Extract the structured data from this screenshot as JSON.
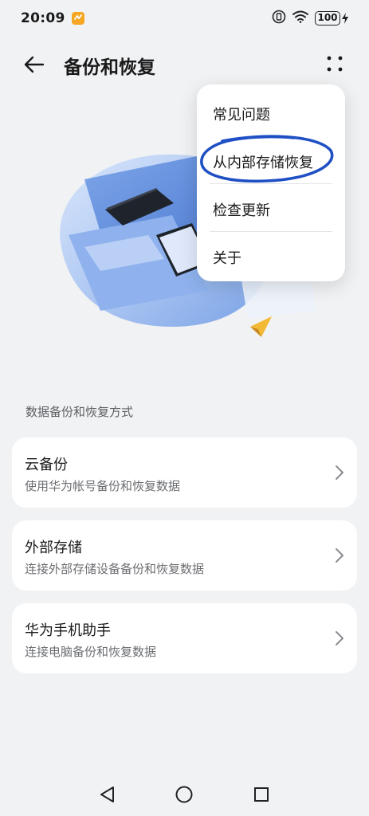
{
  "status_bar": {
    "time": "20:09",
    "battery": "100",
    "icons": [
      "app-notification-icon",
      "vibrate-icon",
      "wifi-icon",
      "battery-icon",
      "charging-icon"
    ]
  },
  "header": {
    "title": "备份和恢复",
    "back_icon": "back-arrow-icon",
    "more_icon": "more-dots-icon"
  },
  "menu": {
    "items": [
      {
        "label": "常见问题"
      },
      {
        "label": "从内部存储恢复"
      },
      {
        "label": "检查更新"
      },
      {
        "label": "关于"
      }
    ],
    "annotation_color": "#1f4fc4"
  },
  "section": {
    "title": "数据备份和恢复方式"
  },
  "cards": [
    {
      "title": "云备份",
      "subtitle": "使用华为帐号备份和恢复数据"
    },
    {
      "title": "外部存储",
      "subtitle": "连接外部存储设备备份和恢复数据"
    },
    {
      "title": "华为手机助手",
      "subtitle": "连接电脑备份和恢复数据"
    }
  ],
  "nav_bar": {
    "icons": [
      "back-triangle-icon",
      "home-circle-icon",
      "recents-square-icon"
    ]
  }
}
